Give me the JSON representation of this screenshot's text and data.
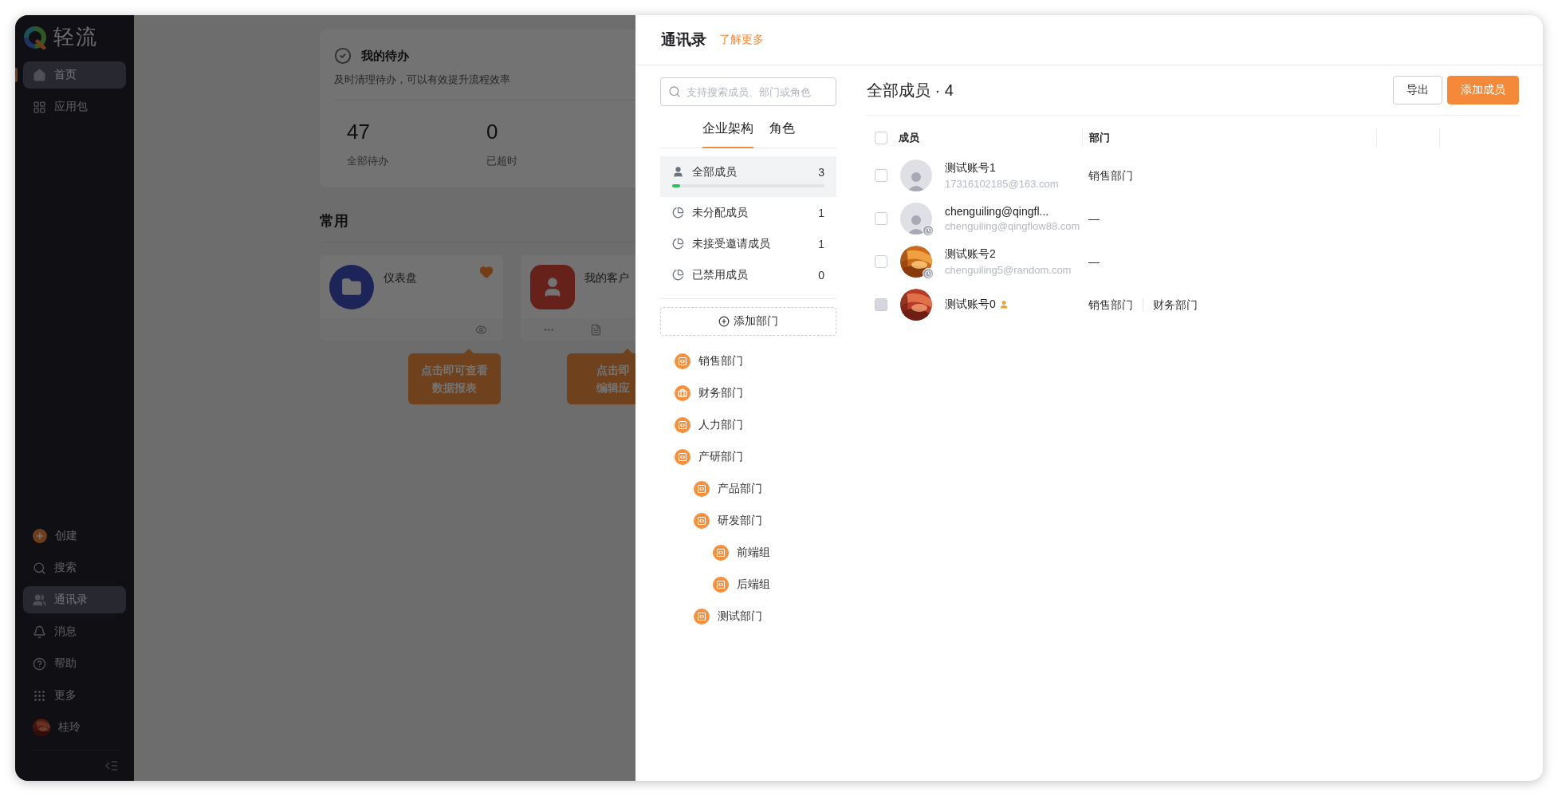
{
  "sidebar": {
    "logo": "轻流",
    "items": [
      {
        "label": "首页",
        "kind": "home",
        "selected": true
      },
      {
        "label": "应用包",
        "kind": "grid",
        "selected": false
      }
    ],
    "bottom_items": [
      {
        "label": "创建",
        "kind": "create",
        "active": false
      },
      {
        "label": "搜索",
        "kind": "search",
        "active": false
      },
      {
        "label": "通讯录",
        "kind": "contacts",
        "active": true
      },
      {
        "label": "消息",
        "kind": "bell",
        "active": false
      },
      {
        "label": "帮助",
        "kind": "help",
        "active": false
      },
      {
        "label": "更多",
        "kind": "more",
        "active": false
      },
      {
        "label": "桂玲",
        "kind": "avatar",
        "active": false
      }
    ]
  },
  "todo": {
    "title": "我的待办",
    "description": "及时清理待办，可以有效提升流程效率",
    "stats": [
      {
        "value": "47",
        "label": "全部待办"
      },
      {
        "value": "0",
        "label": "已超时"
      }
    ]
  },
  "favorites": {
    "title": "常用",
    "apps": [
      {
        "name": "仪表盘",
        "kind": "dashboard",
        "favorited": true,
        "tip": [
          "点击即可查看",
          "数据报表"
        ]
      },
      {
        "name": "我的客户",
        "kind": "form",
        "tip": [
          "点击即",
          "编辑应"
        ]
      }
    ]
  },
  "drawer": {
    "title": "通讯录",
    "link": "了解更多",
    "search": {
      "placeholder": "支持搜索成员、部门或角色"
    },
    "tabs": [
      {
        "label": "企业架构",
        "selected": true
      },
      {
        "label": "角色",
        "selected": false
      }
    ],
    "groups": [
      {
        "label": "全部成员",
        "count": "3",
        "kind": "all",
        "selected": true,
        "level": 0.05
      },
      {
        "label": "未分配成员",
        "count": "1",
        "kind": "status",
        "selected": false
      },
      {
        "label": "未接受邀请成员",
        "count": "1",
        "kind": "status",
        "selected": false
      },
      {
        "label": "已禁用成员",
        "count": "0",
        "kind": "status",
        "selected": false
      }
    ],
    "add_department": "添加部门",
    "departments": [
      {
        "name": "销售部门",
        "kind": "code"
      },
      {
        "name": "财务部门",
        "kind": "briefcase"
      },
      {
        "name": "人力部门",
        "kind": "code"
      },
      {
        "name": "产研部门",
        "kind": "code",
        "children": [
          {
            "name": "产品部门",
            "kind": "code"
          },
          {
            "name": "研发部门",
            "kind": "code",
            "children": [
              {
                "name": "前端组",
                "kind": "code"
              },
              {
                "name": "后端组",
                "kind": "code"
              }
            ]
          },
          {
            "name": "测试部门",
            "kind": "code"
          }
        ]
      }
    ],
    "members": {
      "title": "全部成员 · 4",
      "buttons": [
        {
          "label": "导出",
          "kind": "secondary"
        },
        {
          "label": "添加成员",
          "kind": "primary"
        }
      ],
      "header_checked": false,
      "columns": [
        "成员",
        "部门"
      ],
      "rows": [
        {
          "name": "测试账号1",
          "email": "17316102185@163.com",
          "kind": "default",
          "pending": false,
          "admin": false,
          "checked": false,
          "disabled": false,
          "departments": [
            "销售部门"
          ]
        },
        {
          "name": "chenguiling@qingfl...",
          "email": "chenguiling@qingflow88.com",
          "kind": "default",
          "pending": true,
          "admin": false,
          "checked": false,
          "disabled": false,
          "departments": [
            "—"
          ]
        },
        {
          "name": "测试账号2",
          "email": "chenguiling5@random.com",
          "pending": true,
          "admin": false,
          "checked": false,
          "disabled": false,
          "departments": [
            "—"
          ]
        },
        {
          "name": "测试账号0",
          "pending": false,
          "admin": true,
          "checked": false,
          "disabled": true,
          "departments": [
            "销售部门",
            "财务部门"
          ]
        }
      ]
    }
  }
}
